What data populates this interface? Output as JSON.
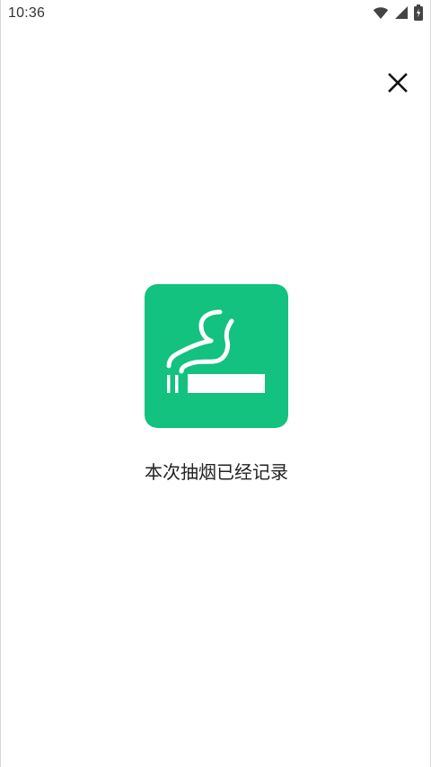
{
  "status_bar": {
    "time": "10:36",
    "icons": [
      "wifi-icon",
      "cellular-signal-icon",
      "battery-charging-icon"
    ]
  },
  "controls": {
    "close_icon": "close-icon"
  },
  "record_card": {
    "icon": "smoking-icon",
    "background_color": "#12C27E",
    "foreground_color": "#ffffff"
  },
  "message": {
    "text": "本次抽烟已经记录"
  }
}
